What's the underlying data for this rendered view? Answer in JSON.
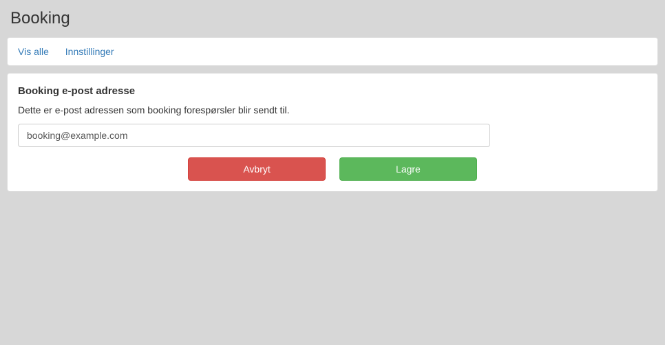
{
  "header": {
    "title": "Booking"
  },
  "nav": {
    "items": [
      {
        "label": "Vis alle"
      },
      {
        "label": "Innstillinger"
      }
    ]
  },
  "form": {
    "section_title": "Booking e-post adresse",
    "section_description": "Dette er e-post adressen som booking forespørsler blir sendt til.",
    "email_value": "booking@example.com",
    "buttons": {
      "cancel": "Avbryt",
      "save": "Lagre"
    }
  }
}
